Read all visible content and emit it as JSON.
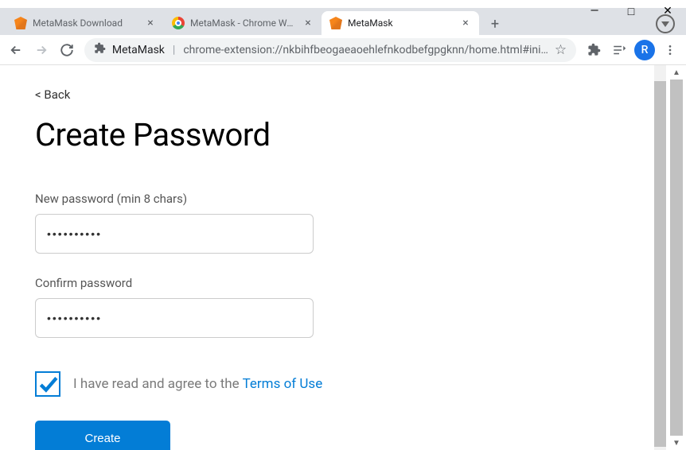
{
  "window": {
    "minimize": "—",
    "maximize": "□",
    "close": "✕"
  },
  "tabs": [
    {
      "title": "MetaMask Download",
      "active": false
    },
    {
      "title": "MetaMask - Chrome Web",
      "active": false
    },
    {
      "title": "MetaMask",
      "active": true
    }
  ],
  "toolbar": {
    "origin": "MetaMask",
    "path": "chrome-extension://nkbihfbeogaeaoehlefnkodbefgpgknn/home.html#ini…",
    "profile_letter": "R"
  },
  "page": {
    "back": "< Back",
    "title": "Create Password",
    "new_password_label": "New password (min 8 chars)",
    "new_password_value": "••••••••••",
    "confirm_password_label": "Confirm password",
    "confirm_password_value": "••••••••••",
    "tos_text": "I have read and agree to the ",
    "tos_link": "Terms of Use",
    "create_button": "Create",
    "checkbox_checked": true
  }
}
